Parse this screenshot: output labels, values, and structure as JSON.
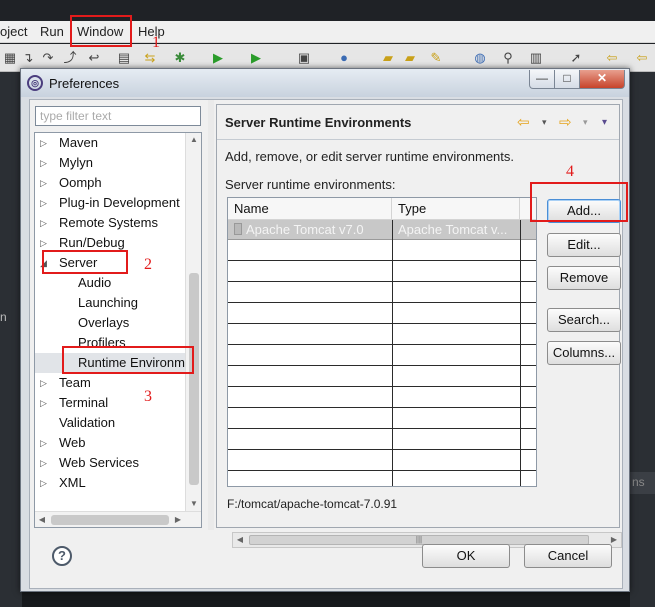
{
  "menubar": {
    "items": [
      "oject",
      "Run",
      "Window",
      "Help"
    ]
  },
  "toolbar_icons": [
    "new-icon",
    "save-icon",
    "step-into-icon",
    "step-over-icon",
    "step-return-icon",
    "drop-frame-icon",
    "use-step-filters-icon",
    "debug-icon",
    "run-icon",
    "external-tools-icon",
    "new-server-icon",
    "new-class-icon",
    "open-type-icon",
    "open-folder-icon",
    "search-icon",
    "globe-icon",
    "new-wizard-icon",
    "edit-icon",
    "annotation-icon",
    "back-icon",
    "forward-icon"
  ],
  "dialog": {
    "title": "Preferences",
    "window_controls": {
      "minimize": "—",
      "maximize": "□",
      "close": "✕"
    },
    "filter_placeholder": "type filter text",
    "tree": [
      {
        "label": "Maven",
        "expander": "▷"
      },
      {
        "label": "Mylyn",
        "expander": "▷"
      },
      {
        "label": "Oomph",
        "expander": "▷"
      },
      {
        "label": "Plug-in Development",
        "expander": "▷"
      },
      {
        "label": "Remote Systems",
        "expander": "▷"
      },
      {
        "label": "Run/Debug",
        "expander": "▷"
      },
      {
        "label": "Server",
        "expander": "◢"
      },
      {
        "label": "Audio",
        "expander": ""
      },
      {
        "label": "Launching",
        "expander": ""
      },
      {
        "label": "Overlays",
        "expander": ""
      },
      {
        "label": "Profilers",
        "expander": ""
      },
      {
        "label": "Runtime Environm",
        "expander": ""
      },
      {
        "label": "Team",
        "expander": "▷"
      },
      {
        "label": "Terminal",
        "expander": "▷"
      },
      {
        "label": "Validation",
        "expander": ""
      },
      {
        "label": "Web",
        "expander": "▷"
      },
      {
        "label": "Web Services",
        "expander": "▷"
      },
      {
        "label": "XML",
        "expander": "▷"
      }
    ],
    "page": {
      "title": "Server Runtime Environments",
      "nav": {
        "back": "⇦",
        "forward": "⇨",
        "dropdown": "▾"
      },
      "description": "Add, remove, or edit server runtime environments.",
      "list_label": "Server runtime environments:",
      "columns": [
        "Name",
        "Type"
      ],
      "rows": [
        {
          "name": "Apache Tomcat v7.0",
          "type": "Apache Tomcat v..."
        }
      ],
      "buttons": {
        "add": "Add...",
        "edit": "Edit...",
        "remove": "Remove",
        "search": "Search...",
        "columns": "Columns..."
      },
      "location": "F:/tomcat/apache-tomcat-7.0.91"
    },
    "help": "?",
    "ok": "OK",
    "cancel": "Cancel"
  },
  "annotations": [
    "1",
    "2",
    "3",
    "4"
  ],
  "background": {
    "side_text": "n",
    "tab_text": "ns"
  },
  "colors": {
    "annotation": "#e21b1b",
    "dialog_bg": "#f0f0f0",
    "titlebar": "#c8d2de"
  }
}
